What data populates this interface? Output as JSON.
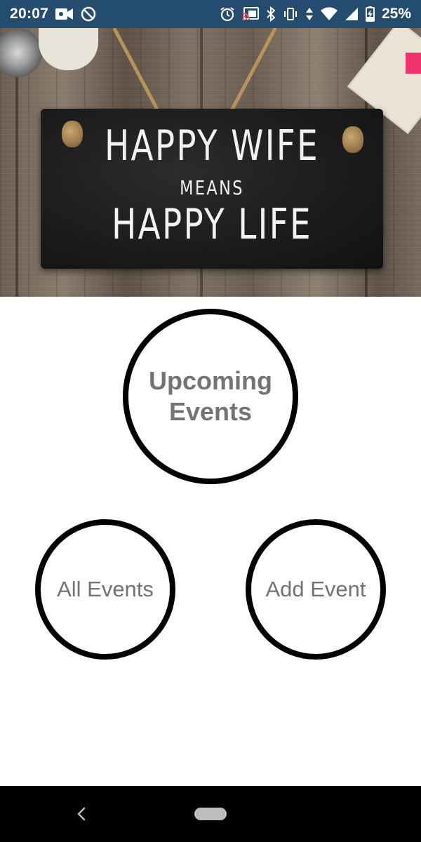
{
  "status_bar": {
    "time": "20:07",
    "battery_percent": "25%",
    "left_icons": [
      "video-camera-icon",
      "do-not-disturb-icon"
    ],
    "right_icons": [
      "alarm-icon",
      "cast-icon",
      "bluetooth-icon",
      "vibrate-icon",
      "data-arrows-icon",
      "wifi-icon",
      "cell-signal-icon",
      "battery-charging-icon"
    ],
    "background_color": "#234c6e"
  },
  "hero": {
    "sign_line_1": "HAPPY WIFE",
    "sign_line_2": "MEANS",
    "sign_line_3": "HAPPY LIFE"
  },
  "buttons": {
    "upcoming_events": "Upcoming Events",
    "all_events": "All Events",
    "add_event": "Add Event"
  },
  "colors": {
    "button_border": "#000000",
    "button_text": "#737373",
    "nav_background": "#000000"
  },
  "nav_bar": {
    "icons": [
      "back-icon",
      "home-pill-icon"
    ]
  }
}
